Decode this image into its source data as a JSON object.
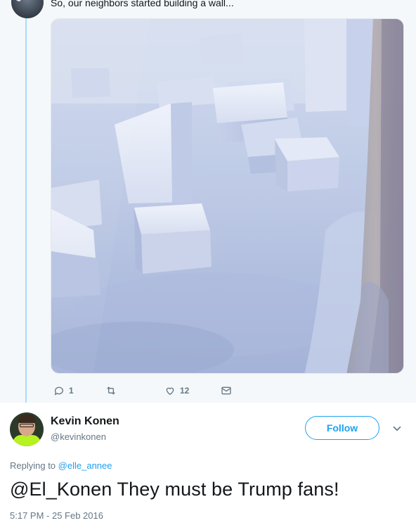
{
  "parent_tweet": {
    "text": "So, our neighbors started building a wall...",
    "actions": {
      "reply_count": "1",
      "like_count": "12"
    }
  },
  "reply_tweet": {
    "display_name": "Kevin Konen",
    "handle": "@kevinkonen",
    "follow_label": "Follow",
    "replying_prefix": "Replying to",
    "replying_to": "@elle_annee",
    "text": "@El_Konen They must be Trump fans!",
    "timestamp": "5:17 PM - 25 Feb 2016"
  },
  "colors": {
    "accent": "#1da1f2",
    "thread_line": "#a9dcf8",
    "muted": "#657786",
    "parent_bg": "#f5f8fa"
  },
  "icons": {
    "reply": "reply-icon",
    "retweet": "retweet-icon",
    "like": "heart-icon",
    "dm": "envelope-icon",
    "more": "chevron-down-icon"
  }
}
